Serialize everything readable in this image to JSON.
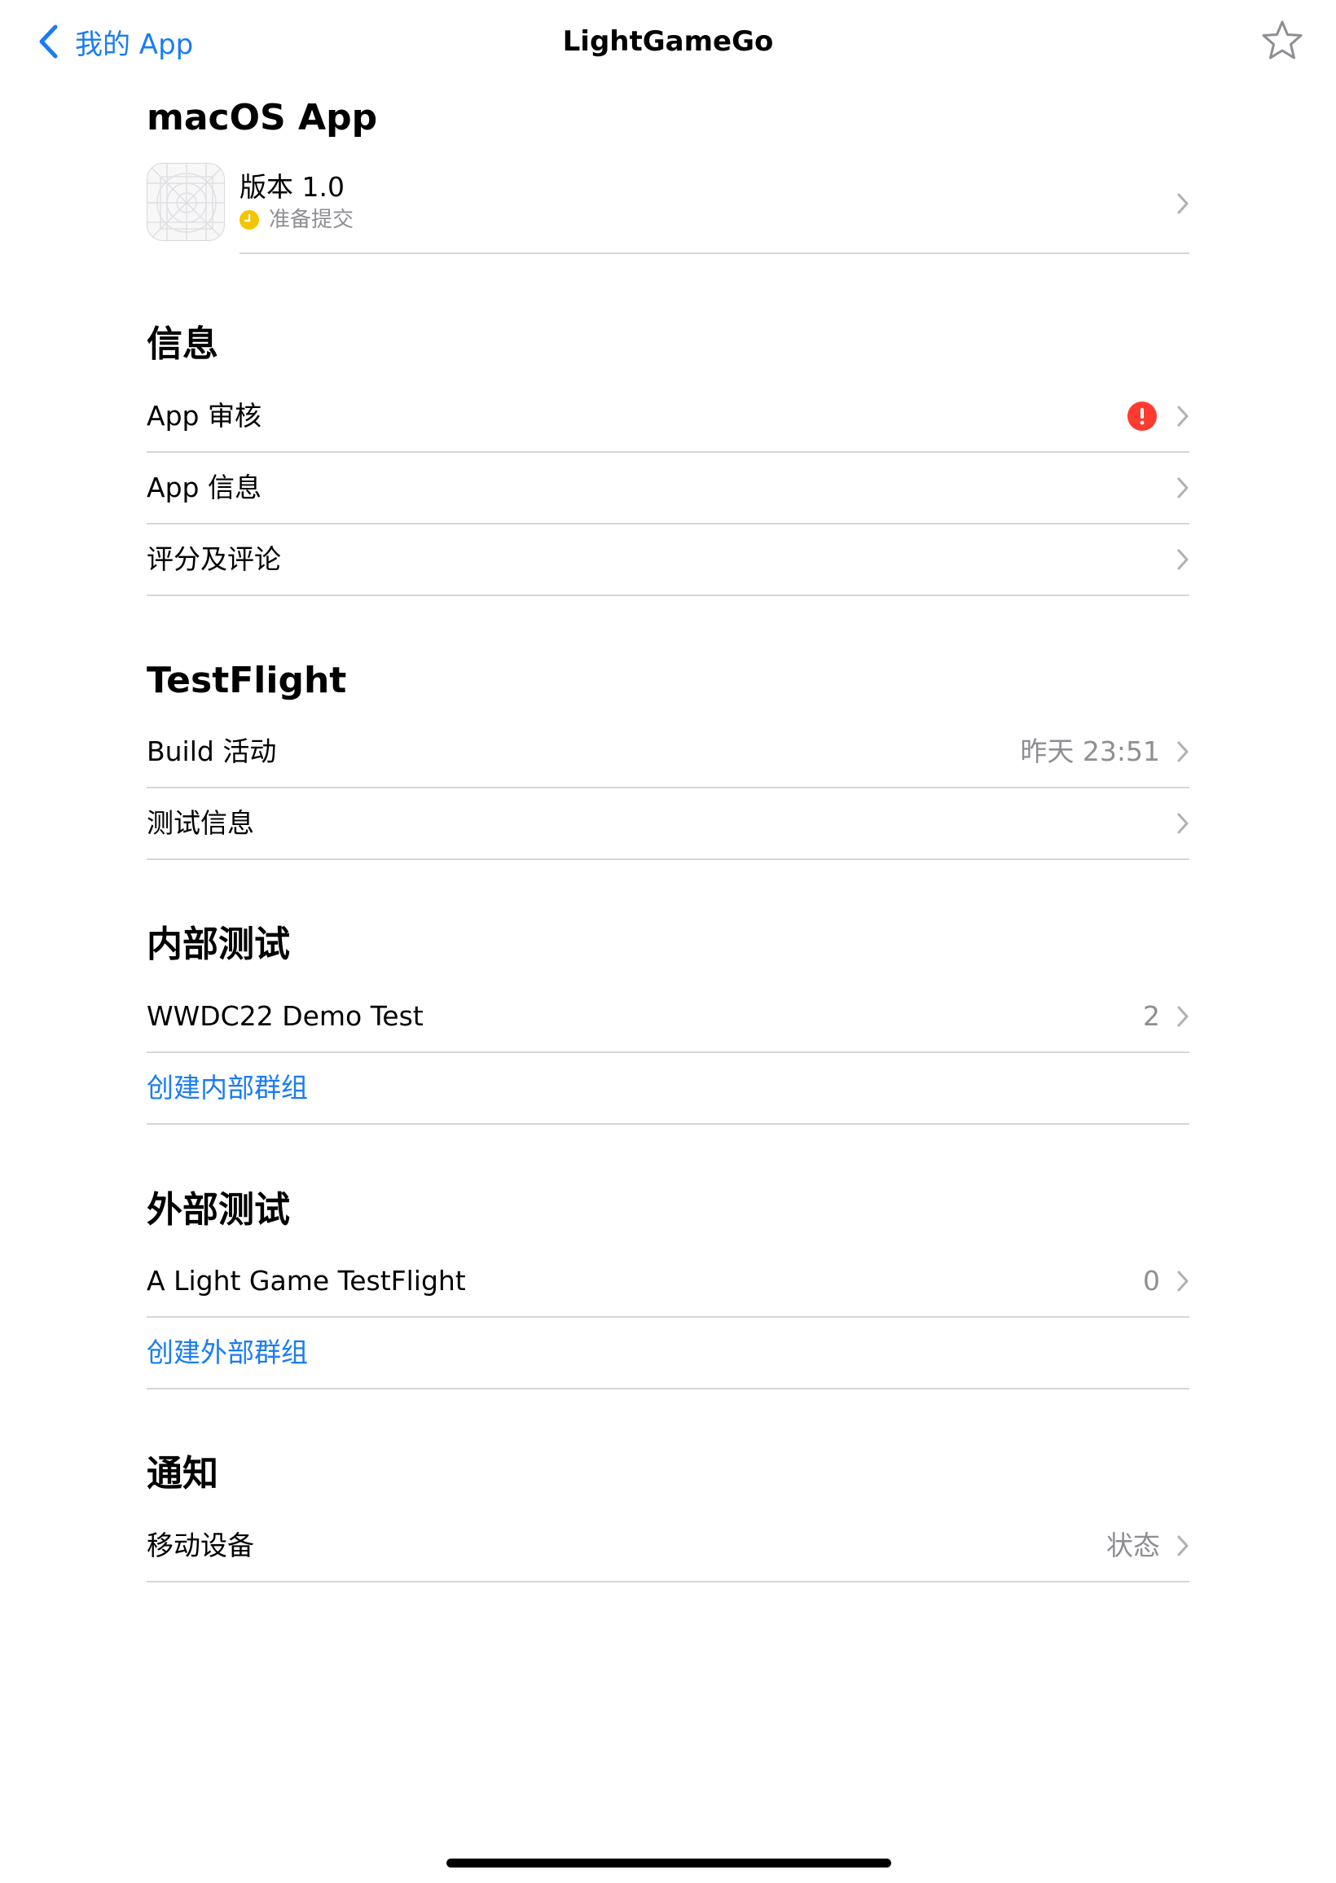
{
  "nav": {
    "back_label": "我的 App",
    "title": "LightGameGo"
  },
  "macos": {
    "title": "macOS App",
    "version_label": "版本 1.0",
    "version_status": "准备提交"
  },
  "info": {
    "title": "信息",
    "rows": [
      {
        "label": "App 审核",
        "has_alert": true
      },
      {
        "label": "App 信息"
      },
      {
        "label": "评分及评论"
      }
    ]
  },
  "testflight": {
    "title": "TestFlight",
    "rows": [
      {
        "label": "Build 活动",
        "value": "昨天 23:51"
      },
      {
        "label": "测试信息"
      }
    ]
  },
  "internal": {
    "title": "内部测试",
    "rows": [
      {
        "label": "WWDC22 Demo Test",
        "value": "2"
      }
    ],
    "create_label": "创建内部群组"
  },
  "external": {
    "title": "外部测试",
    "rows": [
      {
        "label": "A Light Game TestFlight",
        "value": "0"
      }
    ],
    "create_label": "创建外部群组"
  },
  "notifications": {
    "title": "通知",
    "rows": [
      {
        "label": "移动设备",
        "value": "状态"
      }
    ]
  },
  "colors": {
    "accent": "#1a7cf4",
    "alert": "#ff3b30",
    "status_pending": "#f5c400",
    "secondary_text": "#8e8e93",
    "separator": "#d6d6da"
  },
  "icons": [
    "chevron-left-icon",
    "star-icon",
    "app-placeholder-icon",
    "clock-icon",
    "exclamation-icon",
    "chevron-right-icon"
  ]
}
